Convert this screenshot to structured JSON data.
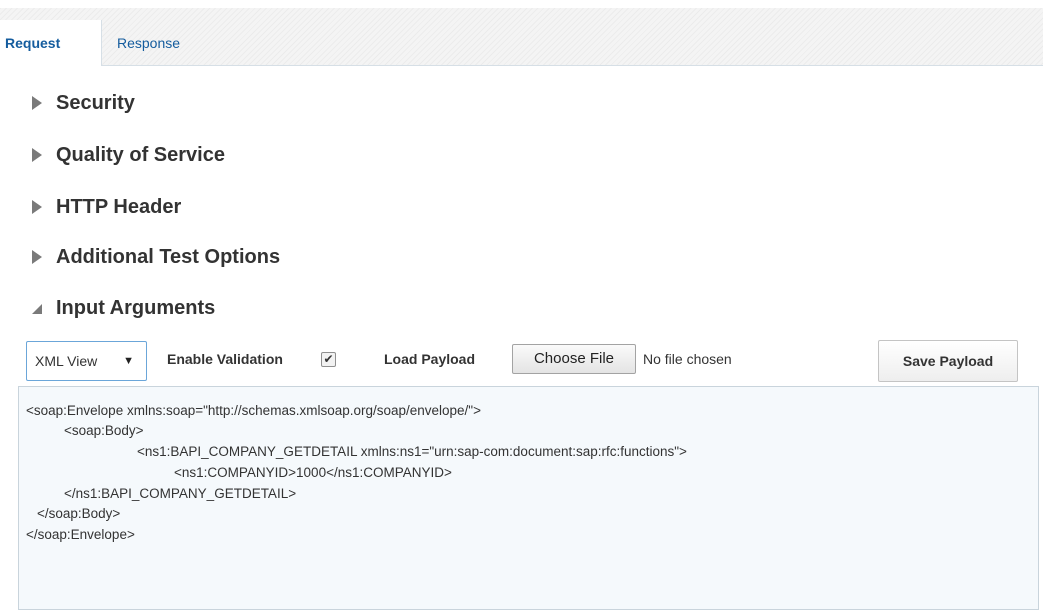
{
  "tabs": {
    "request": "Request",
    "response": "Response"
  },
  "sections": [
    {
      "label": "Security",
      "expanded": false
    },
    {
      "label": "Quality of Service",
      "expanded": false
    },
    {
      "label": "HTTP Header",
      "expanded": false
    },
    {
      "label": "Additional Test Options",
      "expanded": false
    },
    {
      "label": "Input Arguments",
      "expanded": true
    }
  ],
  "toolbar": {
    "view_select": "XML View",
    "view_caret": "▼",
    "enable_validation_label": "Enable Validation",
    "enable_validation_checked": true,
    "checkmark": "✔",
    "load_payload_label": "Load Payload",
    "choose_file": "Choose File",
    "no_file": "No file chosen",
    "save_payload": "Save Payload"
  },
  "payload_lines": [
    "<soap:Envelope xmlns:soap=\"http://schemas.xmlsoap.org/soap/envelope/\">",
    "<soap:Body>",
    "<ns1:BAPI_COMPANY_GETDETAIL xmlns:ns1=\"urn:sap-com:document:sap:rfc:functions\">",
    "<ns1:COMPANYID>1000</ns1:COMPANYID>",
    "</ns1:BAPI_COMPANY_GETDETAIL>",
    "</soap:Body>",
    "</soap:Envelope>"
  ],
  "colors": {
    "tab_active": "#145c9e",
    "select_border": "#6ba6d9",
    "editor_bg": "#f5f9fc"
  },
  "icons": {
    "collapsed": "triangle-right-icon",
    "expanded": "triangle-down-icon"
  }
}
